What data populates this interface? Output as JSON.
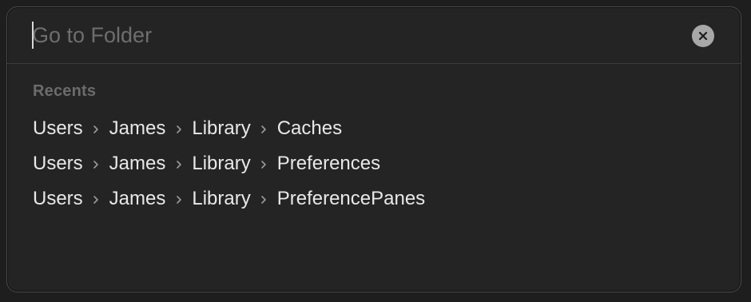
{
  "search": {
    "placeholder": "Go to Folder",
    "value": ""
  },
  "recents": {
    "heading": "Recents",
    "items": [
      {
        "path": [
          "Users",
          "James",
          "Library",
          "Caches"
        ]
      },
      {
        "path": [
          "Users",
          "James",
          "Library",
          "Preferences"
        ]
      },
      {
        "path": [
          "Users",
          "James",
          "Library",
          "PreferencePanes"
        ]
      }
    ]
  },
  "icons": {
    "clear": "close-icon",
    "separator": "chevron-right-icon"
  },
  "colors": {
    "background": "#242424",
    "text": "#e8e8e8",
    "placeholder": "#6e6e6e",
    "section_label": "#6b6b6b",
    "clear_button": "#a8a8a8"
  }
}
